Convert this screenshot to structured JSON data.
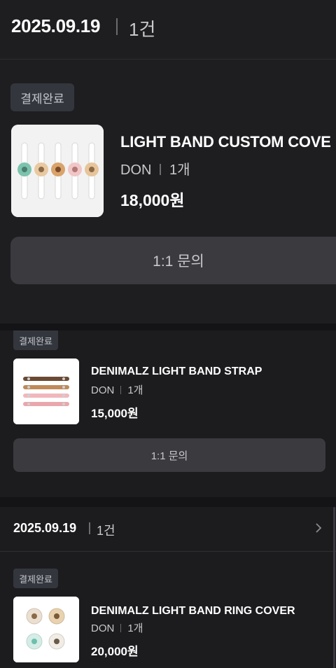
{
  "order1": {
    "date": "2025.09.19",
    "count": "1건",
    "status": "결제완료",
    "item": {
      "name": "LIGHT BAND CUSTOM COVE",
      "option": "DON",
      "qty": "1개",
      "price": "18,000원"
    },
    "inquiry_label": "1:1 문의"
  },
  "order2": {
    "status": "결제완료",
    "item": {
      "name": "DENIMALZ LIGHT BAND STRAP",
      "option": "DON",
      "qty": "1개",
      "price": "15,000원"
    },
    "inquiry_label": "1:1 문의"
  },
  "order3": {
    "date": "2025.09.19",
    "count": "1건",
    "status": "결제완료",
    "item": {
      "name": "DENIMALZ LIGHT BAND RING COVER",
      "option": "DON",
      "qty": "1개",
      "price": "20,000원"
    }
  },
  "icons": {
    "chevron": "chevron-right-icon"
  },
  "colors": {
    "background": "#1c1c1f",
    "badge": "#34363d",
    "button": "#3a3a3f"
  }
}
